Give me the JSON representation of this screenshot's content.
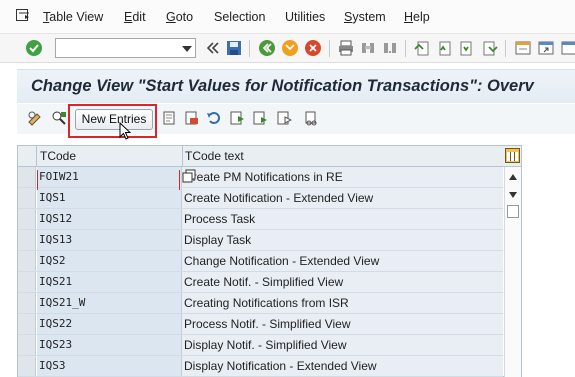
{
  "menubar": {
    "items": [
      {
        "label": "Table View",
        "key": "T",
        "rest": "able View"
      },
      {
        "label": "Edit",
        "key": "E",
        "rest": "dit"
      },
      {
        "label": "Goto",
        "key": "G",
        "rest": "oto"
      },
      {
        "label": "Selection",
        "key": "",
        "rest": "Selection"
      },
      {
        "label": "Utilities",
        "key": "",
        "rest": "Utilities"
      },
      {
        "label": "System",
        "key": "S",
        "rest": "ystem"
      },
      {
        "label": "Help",
        "key": "H",
        "rest": "elp"
      }
    ]
  },
  "toolbar": {
    "command_field_value": ""
  },
  "title": "Change View \"Start Values for Notification Transactions\": Overv",
  "app_toolbar": {
    "new_entries_label": "New Entries"
  },
  "table": {
    "headers": [
      "TCode",
      "TCode text"
    ],
    "rows": [
      {
        "code": "FOIW21",
        "text": "Create PM Notifications in RE"
      },
      {
        "code": "IQS1",
        "text": "Create Notification - Extended View"
      },
      {
        "code": "IQS12",
        "text": "Process Task"
      },
      {
        "code": "IQS13",
        "text": "Display Task"
      },
      {
        "code": "IQS2",
        "text": "Change Notification - Extended View"
      },
      {
        "code": "IQS21",
        "text": "Create Notif. - Simplified View"
      },
      {
        "code": "IQS21_W",
        "text": "Creating Notifications from ISR"
      },
      {
        "code": "IQS22",
        "text": "Process Notif. - Simplified View"
      },
      {
        "code": "IQS23",
        "text": "Display Notif. - Simplified View"
      },
      {
        "code": "IQS3",
        "text": "Display Notification - Extended View"
      }
    ]
  },
  "colors": {
    "highlight": "#d9262c",
    "accent": "#1e2a38"
  }
}
